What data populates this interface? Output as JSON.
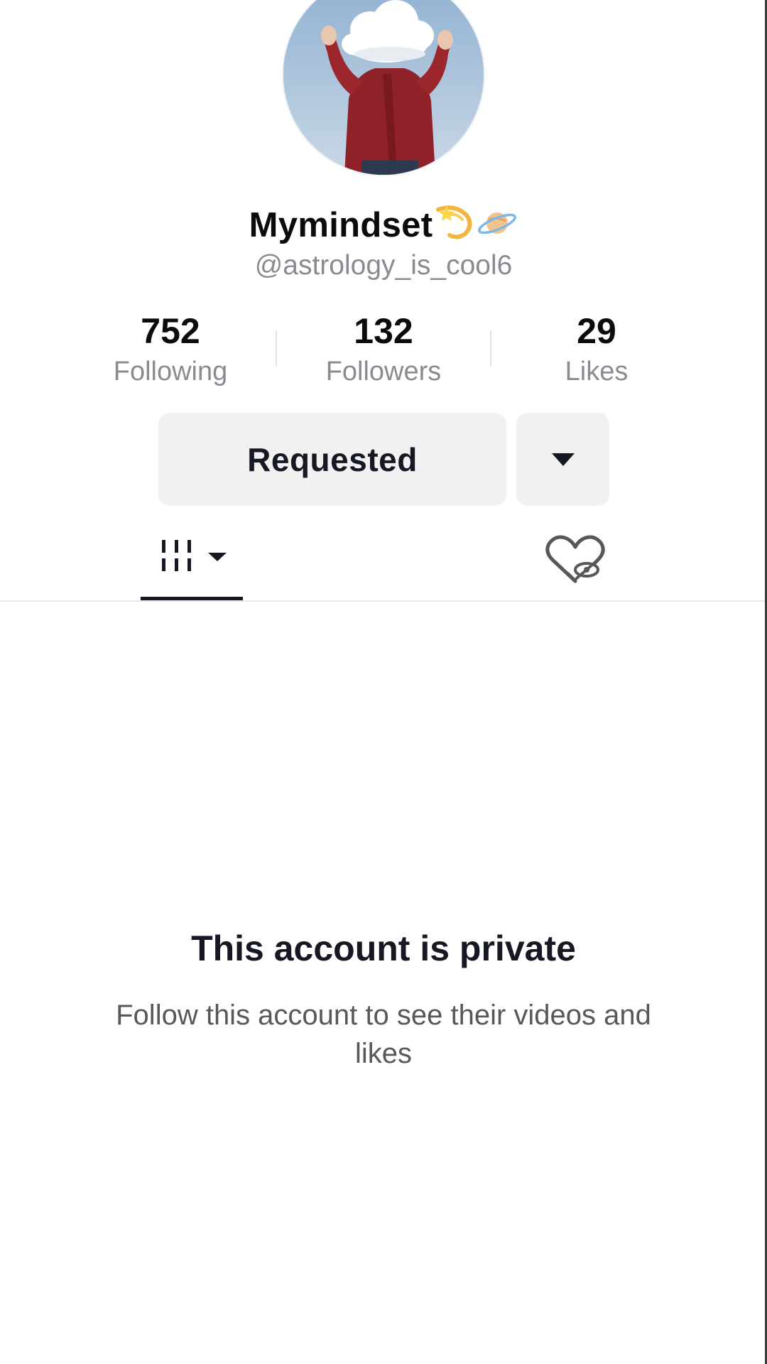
{
  "profile": {
    "display_name": "Mymindset",
    "name_emojis": [
      "dizzy-emoji",
      "ringed-planet-emoji"
    ],
    "username": "@astrology_is_cool6"
  },
  "stats": [
    {
      "value": "752",
      "label": "Following"
    },
    {
      "value": "132",
      "label": "Followers"
    },
    {
      "value": "29",
      "label": "Likes"
    }
  ],
  "actions": {
    "follow_state_label": "Requested",
    "dropdown_icon": "caret-down-icon"
  },
  "tabs": [
    {
      "name": "videos",
      "icon": "grid-icon",
      "has_dropdown": true,
      "selected": true
    },
    {
      "name": "liked",
      "icon": "hidden-liked-heart-icon",
      "selected": false
    }
  ],
  "private_notice": {
    "title": "This account is private",
    "description": "Follow this account to see their videos and likes"
  },
  "colors": {
    "text_primary": "#161823",
    "text_secondary": "#8a8b91",
    "button_bg": "#f1f1f2"
  }
}
